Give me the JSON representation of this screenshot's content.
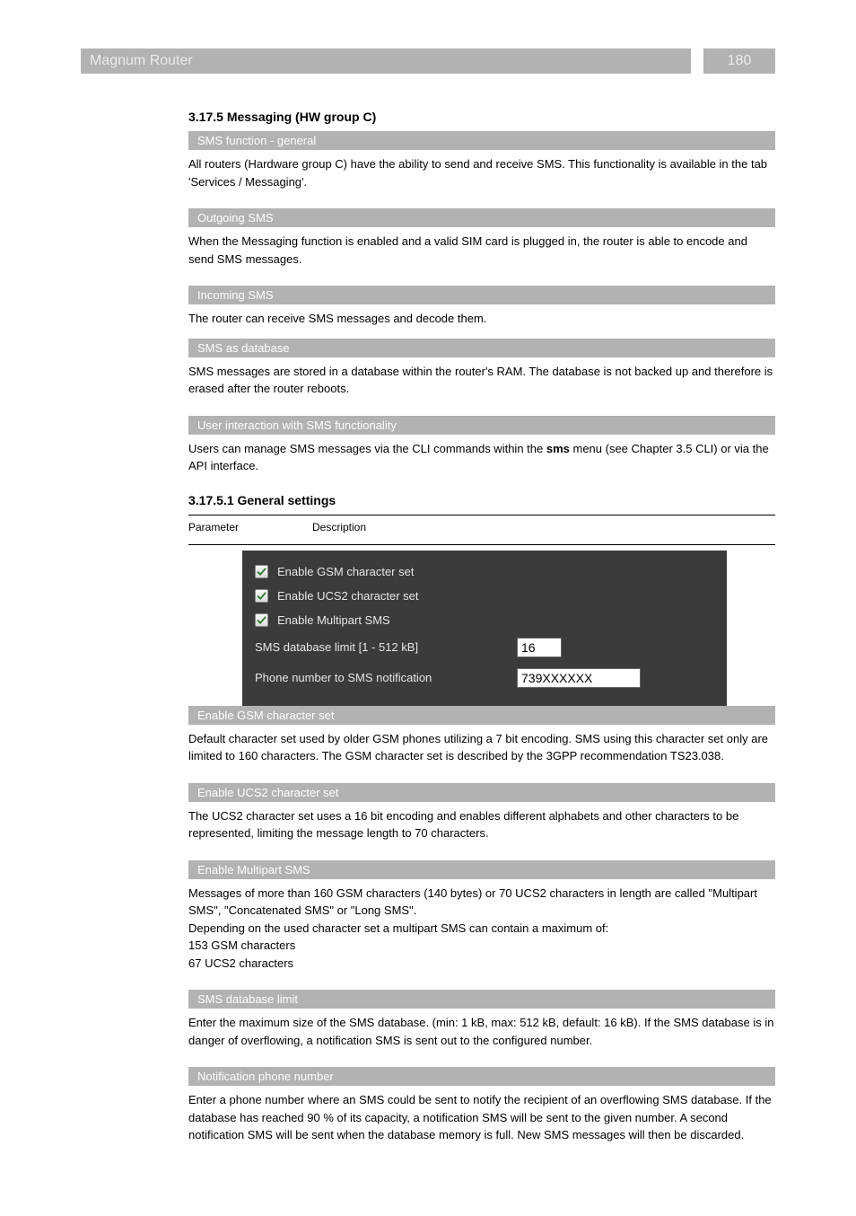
{
  "page": {
    "doc_title": "Magnum Router",
    "number": "180"
  },
  "hw": {
    "title": "3.17.5 Messaging (HW group C)",
    "sms_general": {
      "heading": "SMS function - general",
      "para": "All routers (Hardware group C) have the ability to send and receive SMS. This functionality is available in the tab 'Services / Messaging'."
    },
    "sms_outgoing": {
      "heading": "Outgoing SMS",
      "para": "When the Messaging function is enabled and a valid SIM card is plugged in, the router is able to encode and send SMS messages."
    },
    "sms_incoming": {
      "heading": "Incoming SMS",
      "para": "The router can receive SMS messages and decode them."
    },
    "sms_database": {
      "heading": "SMS as database",
      "para": "SMS messages are stored in a database within the router's RAM. The database is not backed up and therefore is erased after the router reboots."
    },
    "sms_user_interaction": {
      "heading": "User interaction with SMS functionality",
      "para_html": "Users can manage SMS messages via the CLI commands within the <span class=\"bold\">sms</span> menu (see Chapter 3.5 CLI) or via the API interface."
    }
  },
  "table": {
    "section_title": "3.17.5.1 General settings",
    "col_param": "Parameter",
    "col_desc": "Description",
    "screenshot": {
      "row_gsm": "Enable GSM character set",
      "row_ucs2": "Enable UCS2 character set",
      "row_multipart": "Enable Multipart SMS",
      "row_db_limit": "SMS database limit [1 - 512 kB]",
      "row_phone": "Phone number to SMS notification",
      "val_db_limit": "16",
      "val_phone": "739XXXXXX"
    },
    "rows": [
      {
        "label": "Enable GSM character set",
        "desc": "Default character set used by older GSM phones utilizing a 7 bit encoding. SMS using this character set only are limited to 160 characters. The GSM character set is described by the 3GPP recommendation TS23.038."
      },
      {
        "label": "Enable UCS2 character set",
        "desc": "The UCS2 character set uses a 16 bit encoding and enables different alphabets and other characters to be represented, limiting the message length to 70 characters."
      },
      {
        "label": "Enable Multipart SMS",
        "desc_html": "Messages of more than 160 GSM characters (140 bytes) or 70 UCS2 characters in length are called \"Multipart SMS\", \"Concatenated SMS\" or \"Long SMS\".<br>Depending on the used character set a multipart SMS can contain a maximum of:<br>153 GSM characters<br>67 UCS2 characters"
      },
      {
        "label": "SMS database limit",
        "desc": "Enter the maximum size of the SMS database. (min: 1 kB, max: 512 kB, default: 16 kB). If the SMS database is in danger of overflowing, a notification SMS is sent out to the configured number."
      },
      {
        "label": "Notification phone number",
        "desc": "Enter a phone number where an SMS could be sent to notify the recipient of an overflowing SMS database. If the database has reached 90 % of its capacity, a notification SMS will be sent to the given number.\nA second notification SMS will be sent when the database memory is full. New SMS messages will then be discarded."
      }
    ]
  }
}
